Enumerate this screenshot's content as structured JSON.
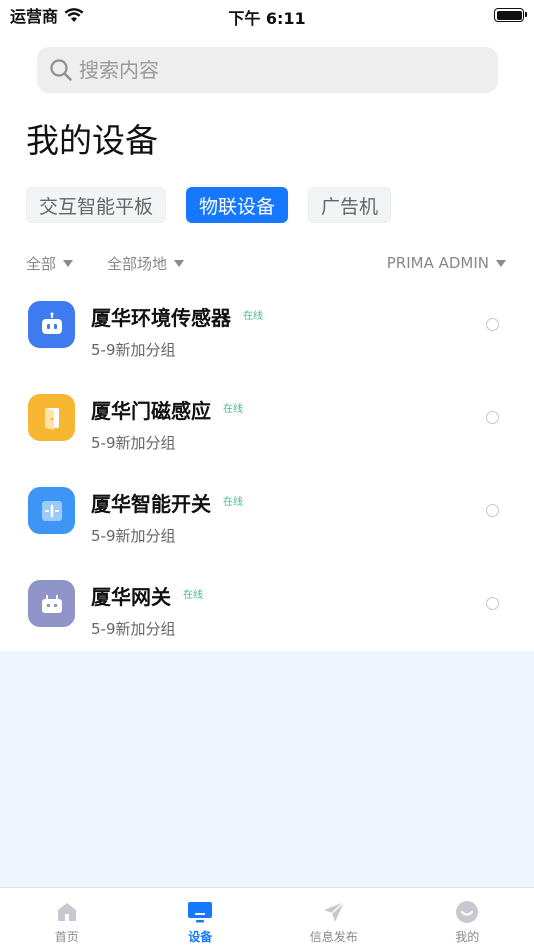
{
  "status_bar": {
    "carrier": "运营商",
    "time": "下午 6:11"
  },
  "search": {
    "placeholder": "搜索内容"
  },
  "page_title": "我的设备",
  "tabs": [
    {
      "label": "交互智能平板",
      "active": false
    },
    {
      "label": "物联设备",
      "active": true
    },
    {
      "label": "广告机",
      "active": false
    }
  ],
  "filters": {
    "all": "全部",
    "location": "全部场地",
    "user": "PRIMA ADMIN"
  },
  "devices": [
    {
      "name": "厦华环境传感器",
      "status": "在线",
      "group": "5-9新加分组",
      "icon": "robot-sensor-icon",
      "color": "#3f7bf0"
    },
    {
      "name": "厦华门磁感应",
      "status": "在线",
      "group": "5-9新加分组",
      "icon": "door-icon",
      "color": "#f7b733"
    },
    {
      "name": "厦华智能开关",
      "status": "在线",
      "group": "5-9新加分组",
      "icon": "switch-icon",
      "color": "#3d96f5"
    },
    {
      "name": "厦华网关",
      "status": "在线",
      "group": "5-9新加分组",
      "icon": "gateway-icon",
      "color": "#8f95c8"
    }
  ],
  "tabbar": [
    {
      "label": "首页",
      "icon": "home-icon",
      "active": false
    },
    {
      "label": "设备",
      "icon": "device-icon",
      "active": true
    },
    {
      "label": "信息发布",
      "icon": "send-icon",
      "active": false
    },
    {
      "label": "我的",
      "icon": "profile-icon",
      "active": false
    }
  ],
  "colors": {
    "accent": "#1677ff",
    "online": "#3fbf8a",
    "empty_bg": "#eff6fd"
  }
}
